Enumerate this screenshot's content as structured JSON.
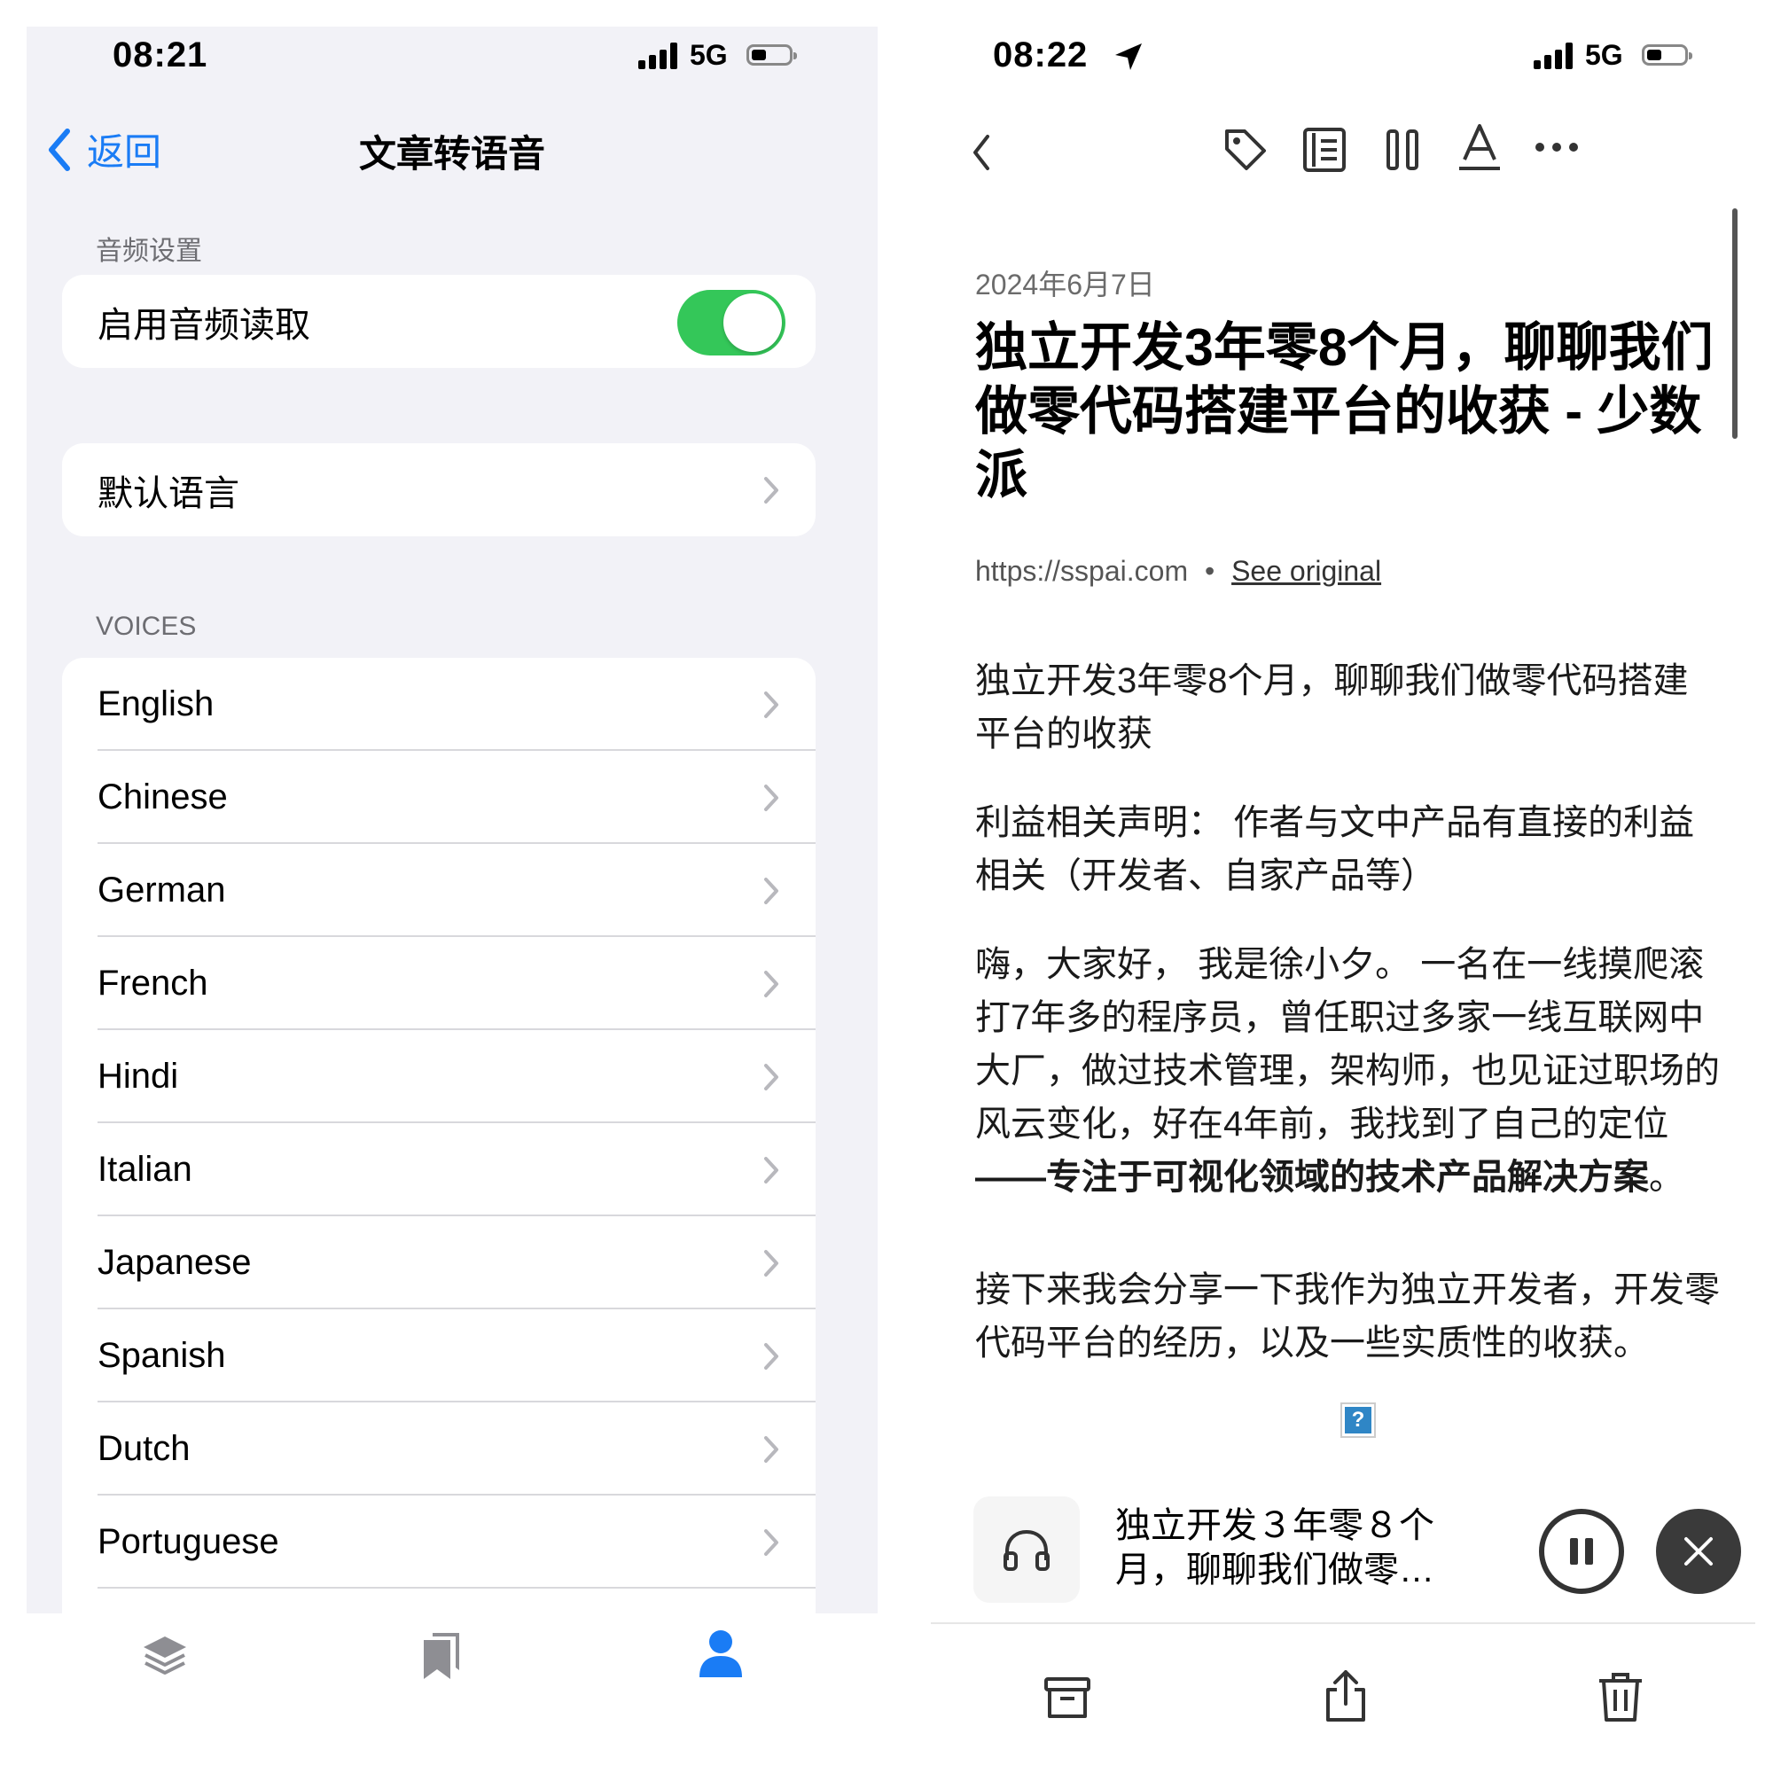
{
  "left": {
    "status": {
      "time": "08:21",
      "network": "5G"
    },
    "nav": {
      "back_label": "返回",
      "title": "文章转语音"
    },
    "audio_section_label": "音频设置",
    "enable_audio_label": "启用音频读取",
    "enable_audio_on": true,
    "default_language_label": "默认语言",
    "voices_section_label": "VOICES",
    "voices": [
      "English",
      "Chinese",
      "German",
      "French",
      "Hindi",
      "Italian",
      "Japanese",
      "Spanish",
      "Dutch",
      "Portuguese"
    ],
    "tabbar": {
      "icons": [
        "layers-icon",
        "bookmarks-icon",
        "person-icon"
      ],
      "active_color": "#1a7cf5"
    }
  },
  "right": {
    "status": {
      "time": "08:22",
      "network": "5G"
    },
    "article": {
      "date": "2024年6月7日",
      "headline_lines": [
        "独立开发3年零8个月，聊聊我们",
        "做零代码搭建平台的收获 - 少数",
        "派"
      ],
      "source_url": "https://sspai.com",
      "bullet": "•",
      "see_original": "See original",
      "paragraphs": [
        [
          "独立开发3年零8个月，聊聊我们做零代码搭建",
          "平台的收获"
        ],
        [
          "利益相关声明：  作者与文中产品有直接的利益",
          "相关（开发者、自家产品等）"
        ],
        [
          "嗨，大家好，  我是徐小夕。  一名在一线摸爬滚",
          "打7年多的程序员，曾任职过多家一线互联网中",
          "大厂，做过技术管理，架构师，也见证过职场的",
          "风云变化，好在4年前，我找到了自己的定位"
        ],
        [
          "接下来我会分享一下我作为独立开发者，开发零",
          "代码平台的经历，以及一些实质性的收获。"
        ]
      ],
      "bold_line": "——专注于可视化领域的技术产品解决方案",
      "bold_line_tail": "。",
      "image_placeholder": "?"
    },
    "player": {
      "title_lines": [
        "独立开发３年零８个",
        "月，聊聊我们做零…"
      ]
    },
    "accent": "#1a7cf5"
  }
}
